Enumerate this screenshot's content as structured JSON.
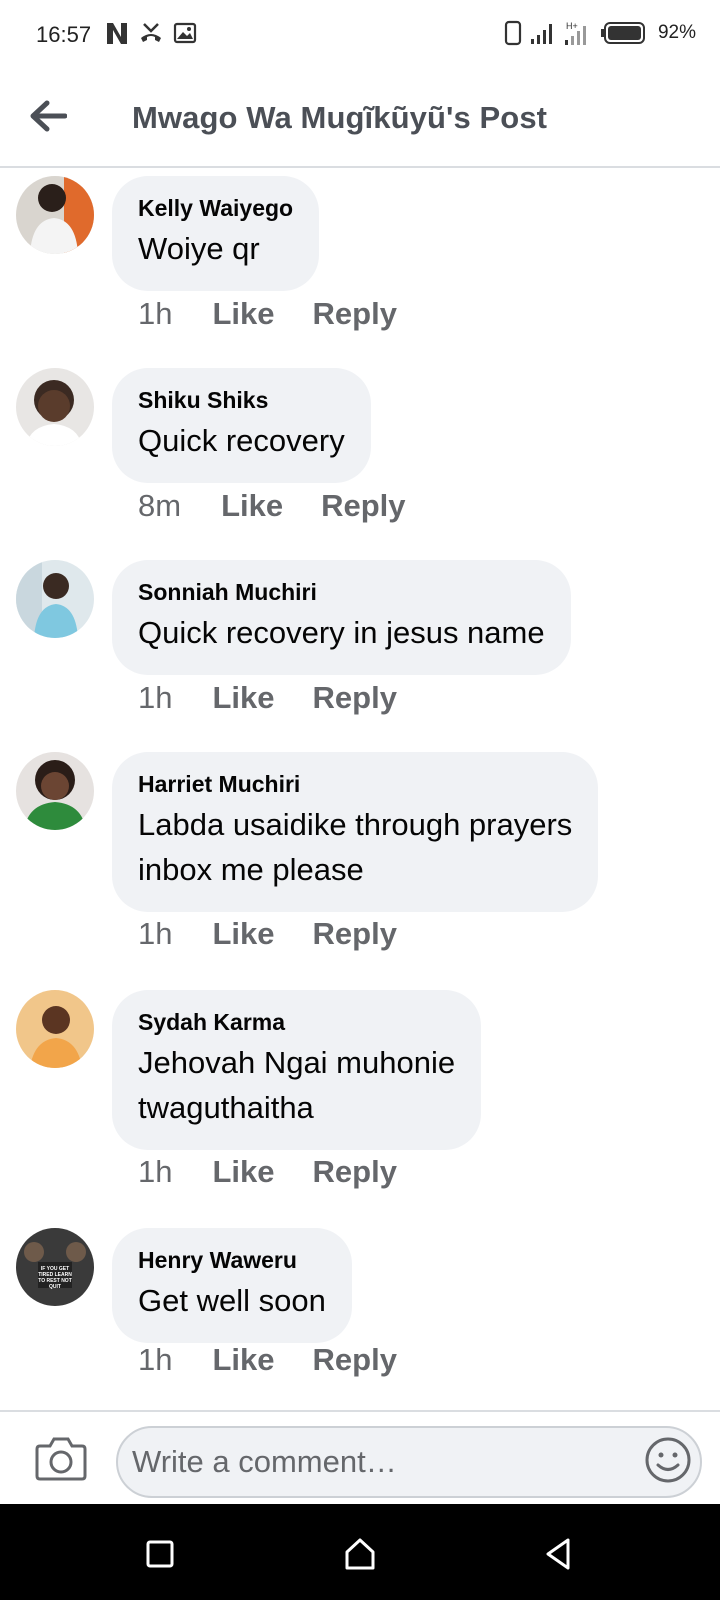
{
  "status_bar": {
    "time": "16:57",
    "battery_percent": "92%"
  },
  "header": {
    "title": "Mwago Wa Mugĩkũyũ's Post"
  },
  "comments": [
    {
      "author": "Kelly Waiyego",
      "text": "Woiye qr",
      "time": "1h",
      "like": "Like",
      "reply": "Reply",
      "avatar_color": "#e06a2c"
    },
    {
      "author": "Shiku Shiks",
      "text": "Quick recovery",
      "time": "8m",
      "like": "Like",
      "reply": "Reply",
      "avatar_color": "#4a3a32"
    },
    {
      "author": "Sonniah Muchiri",
      "text": "Quick recovery in jesus name",
      "time": "1h",
      "like": "Like",
      "reply": "Reply",
      "avatar_color": "#7fc8e0"
    },
    {
      "author": "Harriet Muchiri",
      "text_lines": [
        "Labda usaidike through prayers",
        "inbox me please"
      ],
      "time": "1h",
      "like": "Like",
      "reply": "Reply",
      "avatar_color": "#2e8b3c"
    },
    {
      "author": "Sydah Karma",
      "text_lines": [
        "Jehovah Ngai muhonie",
        "twaguthaitha"
      ],
      "time": "1h",
      "like": "Like",
      "reply": "Reply",
      "avatar_color": "#f2a54a"
    },
    {
      "author": "Henry Waweru",
      "text": "Get well soon",
      "time": "1h",
      "like": "Like",
      "reply": "Reply",
      "avatar_color": "#3a3a3a",
      "avatar_caption": "IF YOU GET TIRED LEARN TO REST NOT QUIT"
    }
  ],
  "composer": {
    "placeholder": "Write a comment…"
  },
  "icons": {
    "back": "arrow-left-icon",
    "camera": "camera-icon",
    "emoji": "smiley-icon",
    "nav": [
      "square-icon",
      "home-icon",
      "back-triangle-icon"
    ]
  },
  "colors": {
    "bubble": "#f0f2f5",
    "secondary_text": "#65676b",
    "title_text": "#4b4f56"
  }
}
